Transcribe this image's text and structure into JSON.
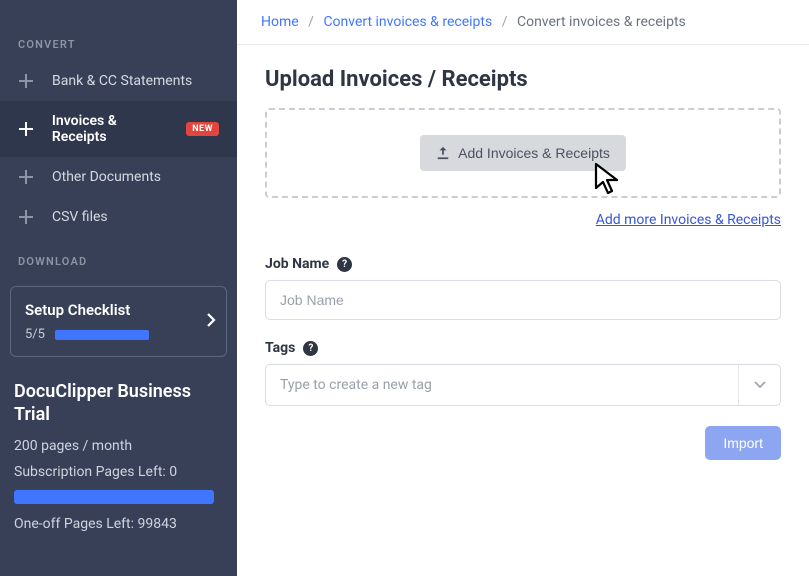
{
  "sidebar": {
    "sections": {
      "convert": "CONVERT",
      "download": "DOWNLOAD"
    },
    "items": [
      {
        "label": "Bank & CC Statements"
      },
      {
        "label": "Invoices & Receipts",
        "badge": "NEW"
      },
      {
        "label": "Other Documents"
      },
      {
        "label": "CSV files"
      }
    ],
    "checklist": {
      "title": "Setup Checklist",
      "count": "5/5"
    },
    "plan": {
      "title": "DocuClipper Business Trial",
      "pages_per_month": "200 pages / month",
      "sub_pages_left": "Subscription Pages Left: 0",
      "oneoff_pages_left": "One-off Pages Left: 99843"
    }
  },
  "breadcrumb": {
    "home": "Home",
    "mid": "Convert invoices & receipts",
    "current": "Convert invoices & receipts"
  },
  "main": {
    "title": "Upload Invoices / Receipts",
    "add_button": "Add Invoices & Receipts",
    "add_more_link": "Add more Invoices & Receipts",
    "job_name_label": "Job Name",
    "job_name_placeholder": "Job Name",
    "tags_label": "Tags",
    "tags_placeholder": "Type to create a new tag",
    "import_button": "Import"
  }
}
